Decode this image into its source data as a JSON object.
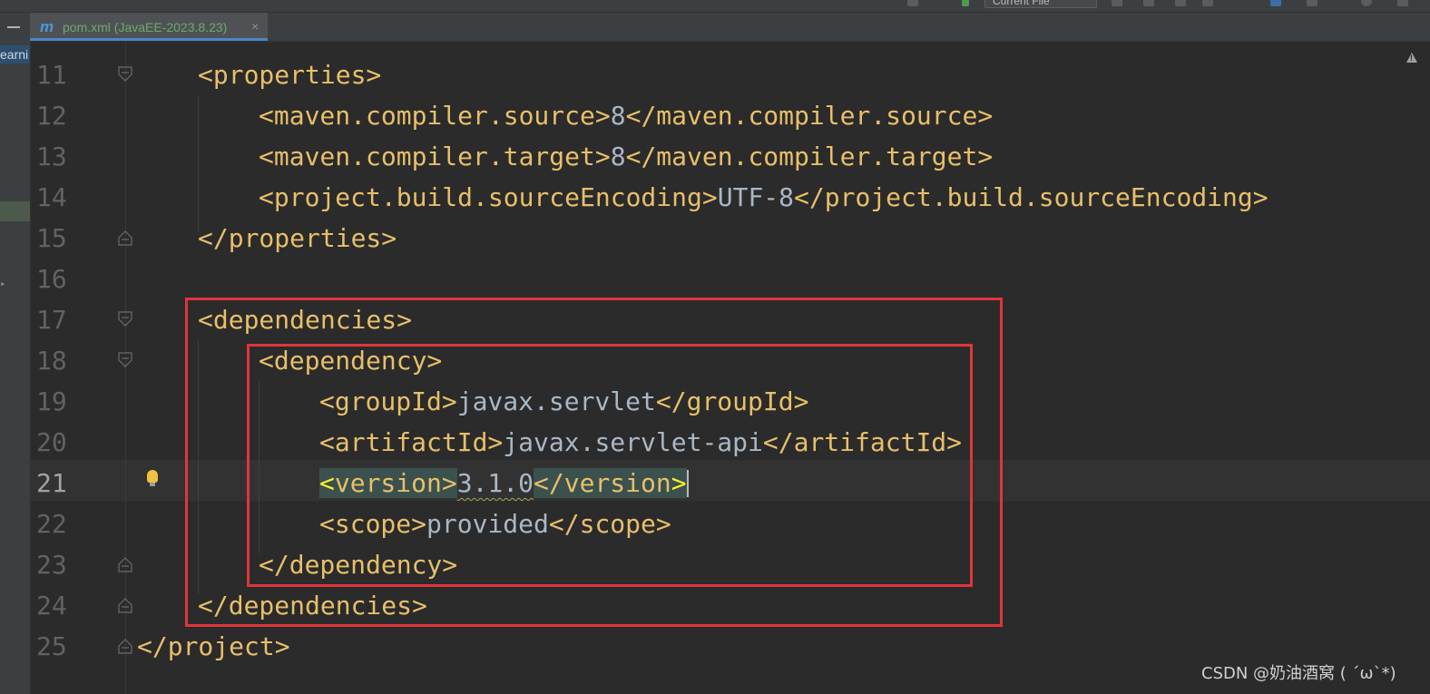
{
  "toolbar": {
    "run_config": "Current File"
  },
  "tab": {
    "icon": "m",
    "title": "pom.xml (JavaEE-2023.8.23)",
    "close": "×"
  },
  "sidebar": {
    "project_label": "earni"
  },
  "editor": {
    "current_line": 21,
    "lines": [
      {
        "n": "11",
        "parts": [
          {
            "t": "<properties>",
            "c": "tag"
          }
        ]
      },
      {
        "n": "12",
        "parts": [
          {
            "t": "<maven.compiler.source>",
            "c": "tag"
          },
          {
            "t": "8",
            "c": "txt"
          },
          {
            "t": "</maven.compiler.source>",
            "c": "tag"
          }
        ]
      },
      {
        "n": "13",
        "parts": [
          {
            "t": "<maven.compiler.target>",
            "c": "tag"
          },
          {
            "t": "8",
            "c": "txt"
          },
          {
            "t": "</maven.compiler.target>",
            "c": "tag"
          }
        ]
      },
      {
        "n": "14",
        "parts": [
          {
            "t": "<project.build.sourceEncoding>",
            "c": "tag"
          },
          {
            "t": "UTF-8",
            "c": "txt"
          },
          {
            "t": "</project.build.sourceEncoding>",
            "c": "tag"
          }
        ]
      },
      {
        "n": "15",
        "parts": [
          {
            "t": "</properties>",
            "c": "tag"
          }
        ]
      },
      {
        "n": "16",
        "parts": []
      },
      {
        "n": "17",
        "parts": [
          {
            "t": "<dependencies>",
            "c": "tag"
          }
        ]
      },
      {
        "n": "18",
        "parts": [
          {
            "t": "<dependency>",
            "c": "tag"
          }
        ]
      },
      {
        "n": "19",
        "parts": [
          {
            "t": "<groupId>",
            "c": "tag"
          },
          {
            "t": "javax.servlet",
            "c": "txt"
          },
          {
            "t": "</groupId>",
            "c": "tag"
          }
        ]
      },
      {
        "n": "20",
        "parts": [
          {
            "t": "<artifactId>",
            "c": "tag"
          },
          {
            "t": "javax.servlet-api",
            "c": "txt"
          },
          {
            "t": "</artifactId>",
            "c": "tag"
          }
        ]
      },
      {
        "n": "21",
        "parts": [
          {
            "t": "<",
            "c": "brace hl"
          },
          {
            "t": "version>",
            "c": "tag hl"
          },
          {
            "t": "3.1.0",
            "c": "txt wavy"
          },
          {
            "t": "</version",
            "c": "tag hl"
          },
          {
            "t": ">",
            "c": "brace hl"
          }
        ]
      },
      {
        "n": "22",
        "parts": [
          {
            "t": "<scope>",
            "c": "tag"
          },
          {
            "t": "provided",
            "c": "txt"
          },
          {
            "t": "</scope>",
            "c": "tag"
          }
        ]
      },
      {
        "n": "23",
        "parts": [
          {
            "t": "</dependency>",
            "c": "tag"
          }
        ]
      },
      {
        "n": "24",
        "parts": [
          {
            "t": "</dependencies>",
            "c": "tag"
          }
        ]
      },
      {
        "n": "25",
        "parts": [
          {
            "t": "</project>",
            "c": "tag"
          }
        ]
      }
    ]
  },
  "colors": {
    "tag": "#e8bf6a",
    "text": "#a9b7c6",
    "highlight_box": "#e0353a"
  },
  "watermark": "CSDN @奶油酒窝 ( ´ω`*)"
}
